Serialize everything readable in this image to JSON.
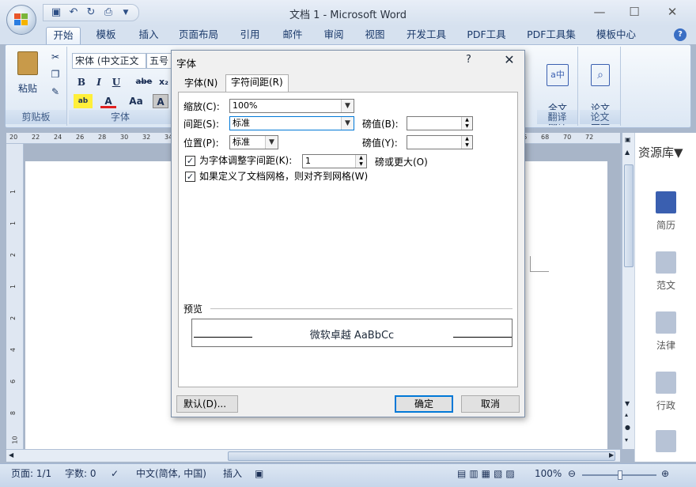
{
  "window": {
    "title": "文档 1 - Microsoft Word",
    "minimize": "—",
    "maximize": "☐",
    "close": "✕"
  },
  "qat": {
    "dropdown": "▼"
  },
  "tabs": [
    "开始",
    "模板",
    "插入",
    "页面布局",
    "引用",
    "邮件",
    "审阅",
    "视图",
    "开发工具",
    "PDF工具",
    "PDF工具集",
    "模板中心"
  ],
  "ribbon": {
    "paste_label": "粘贴",
    "font_name": "宋体 (中文正文",
    "font_size": "五号",
    "bold": "B",
    "italic": "I",
    "underline": "U",
    "strike": "abe",
    "subscript": "x₂",
    "char_scale": "Aa",
    "clipboard_group": "剪贴板",
    "font_group": "字体",
    "translate_label": "全文\n翻译",
    "translate_group": "翻译",
    "paper_label": "论文\n查重",
    "paper_group": "论文"
  },
  "ruler": {
    "numbers": [
      "20",
      "22",
      "24",
      "26",
      "28",
      "30",
      "32",
      "34",
      "66",
      "68",
      "70",
      "72"
    ]
  },
  "vruler": {
    "numbers": [
      "1",
      "1",
      "2",
      "1",
      "2",
      "4",
      "6",
      "8",
      "10"
    ]
  },
  "pane": {
    "title": "资源库▼",
    "items": [
      "简历",
      "范文",
      "法律",
      "行政"
    ]
  },
  "status": {
    "page": "页面: 1/1",
    "words": "字数: 0",
    "language": "中文(简体, 中国)",
    "insert": "插入",
    "zoom": "100%"
  },
  "dialog": {
    "title": "字体",
    "help": "?",
    "close": "✕",
    "tab_font": "字体(N)",
    "tab_spacing": "字符间距(R)",
    "scale_label": "缩放(C):",
    "scale_value": "100%",
    "spacing_label": "间距(S):",
    "spacing_value": "标准",
    "spacing_by_label": "磅值(B):",
    "spacing_by_value": "",
    "position_label": "位置(P):",
    "position_value": "标准",
    "position_by_label": "磅值(Y):",
    "position_by_value": "",
    "kerning_label": "为字体调整字间距(K):",
    "kerning_value": "1",
    "kerning_suffix": "磅或更大(O)",
    "grid_label": "如果定义了文档网格，则对齐到网格(W)",
    "preview_label": "预览",
    "preview_text": "微软卓越 AaBbCc",
    "default_btn": "默认(D)...",
    "ok_btn": "确定",
    "cancel_btn": "取消",
    "kerning_checked": true,
    "grid_checked": true
  },
  "colors": {
    "accent": "#1b3a6b",
    "ribbon_bg": "#dce7f4",
    "pane_icon": "#3a5fb0"
  }
}
